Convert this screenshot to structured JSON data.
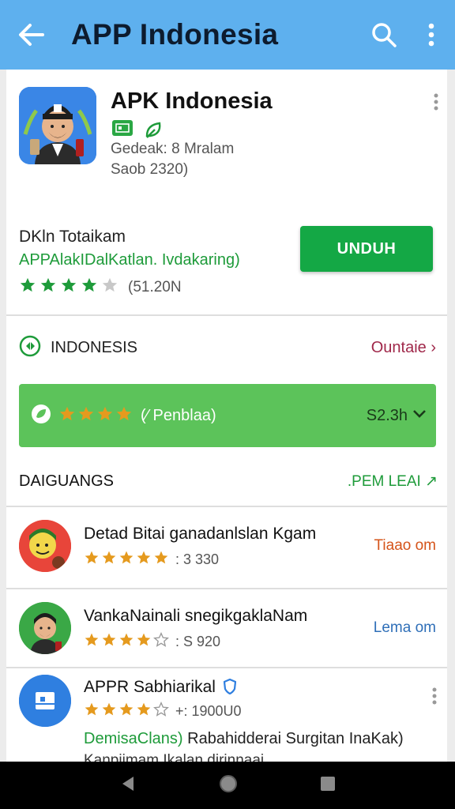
{
  "appbar": {
    "title": "APP Indonesia"
  },
  "app": {
    "name": "APK Indonesia",
    "developer": "Gedeak: 8 Mralam",
    "date": "Saob 2320)"
  },
  "download": {
    "title": "DKln Totaikam",
    "subtitle": "APPAlakIDalKatlan. Ivdakaring)",
    "rating": 4,
    "count": "(51.20N",
    "button": "UNDUH"
  },
  "region": {
    "label": "INDONESIS",
    "link": "Ountaie ›"
  },
  "banner": {
    "stars": 4,
    "text": "(⁄ Penblaa)",
    "price": "S2.3h"
  },
  "section": {
    "title": "DAIGUANGS",
    "link": ".PEM LEAI ↗"
  },
  "rows": [
    {
      "name": "Detad Bitai ganadanlslan Kgam",
      "rating": 5,
      "count": ": 3 330",
      "action": "Tiaao om",
      "action_color": "#d5541a"
    },
    {
      "name": "VankaNainali snegikgaklaNam",
      "rating": 4,
      "count": ": S 920",
      "action": "Lema om",
      "action_color": "#2f6fb8"
    },
    {
      "name": "APPR Sabhiarikal",
      "rating": 4,
      "count": "+: 1900U0",
      "desc_green": "DemisaClans)",
      "desc_rest": " Rabahidderai Surgitan InaKak)",
      "desc2": "Kanpiimam Ikalan dirinnaai"
    }
  ],
  "colors": {
    "appbar": "#5eb0ee",
    "accent_green": "#14a845",
    "star_green": "#1e9b3a",
    "star_orange": "#e59a1e"
  }
}
